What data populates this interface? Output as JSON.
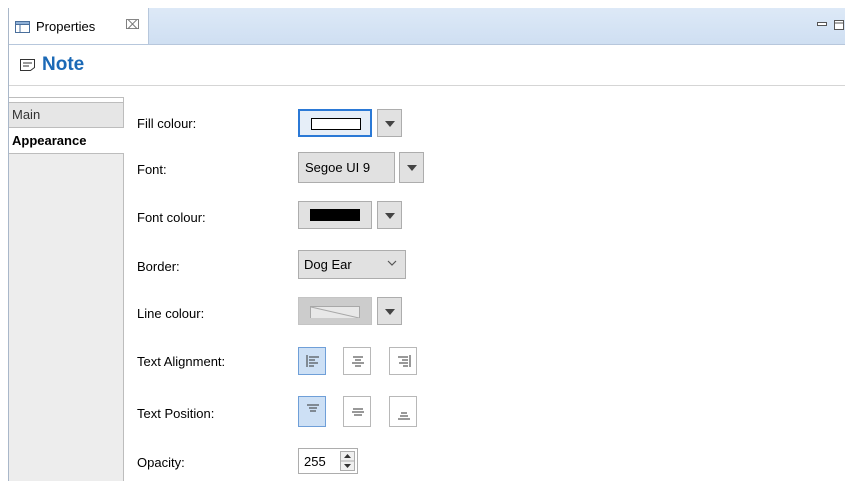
{
  "tab": {
    "label": "Properties",
    "close_glyph": "⌧"
  },
  "header": {
    "title": "Note"
  },
  "sidebar": {
    "items": [
      {
        "label": "Main"
      },
      {
        "label": "Appearance"
      }
    ]
  },
  "fields": {
    "fill_colour": {
      "label": "Fill colour:",
      "swatch": "#ffffff"
    },
    "font": {
      "label": "Font:",
      "value": "Segoe UI 9"
    },
    "font_colour": {
      "label": "Font colour:",
      "swatch": "#000000"
    },
    "border": {
      "label": "Border:",
      "value": "Dog Ear"
    },
    "line_colour": {
      "label": "Line colour:",
      "swatch": "#e8e8e8"
    },
    "text_alignment": {
      "label": "Text Alignment:",
      "selected": "left"
    },
    "text_position": {
      "label": "Text Position:",
      "selected": "top"
    },
    "opacity": {
      "label": "Opacity:",
      "value": "255"
    }
  },
  "colors": {
    "accent": "#2b79d6",
    "title": "#1b69b6",
    "tabbar": "#d6e4f5"
  }
}
